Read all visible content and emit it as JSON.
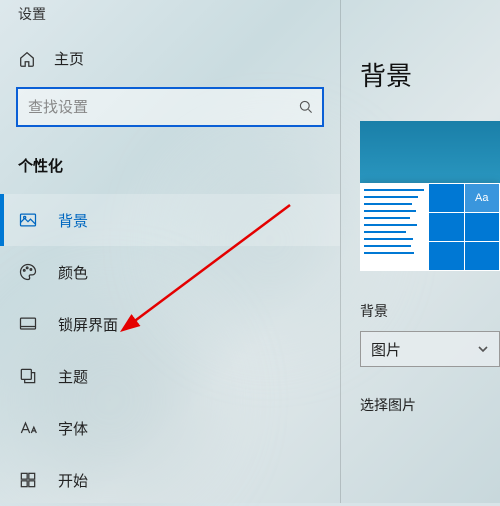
{
  "partial_top_text": "设置",
  "home_label": "主页",
  "search": {
    "placeholder": "查找设置"
  },
  "section": "个性化",
  "sidebar": {
    "items": [
      {
        "label": "背景",
        "icon": "image-icon",
        "selected": true
      },
      {
        "label": "颜色",
        "icon": "palette-icon",
        "selected": false
      },
      {
        "label": "锁屏界面",
        "icon": "lockscreen-icon",
        "selected": false
      },
      {
        "label": "主题",
        "icon": "theme-icon",
        "selected": false
      },
      {
        "label": "字体",
        "icon": "font-icon",
        "selected": false
      },
      {
        "label": "开始",
        "icon": "start-icon",
        "selected": false
      }
    ]
  },
  "content": {
    "title": "背景",
    "preview_aa": "Aa",
    "bg_label": "背景",
    "bg_value": "图片",
    "choose_label": "选择图片"
  }
}
